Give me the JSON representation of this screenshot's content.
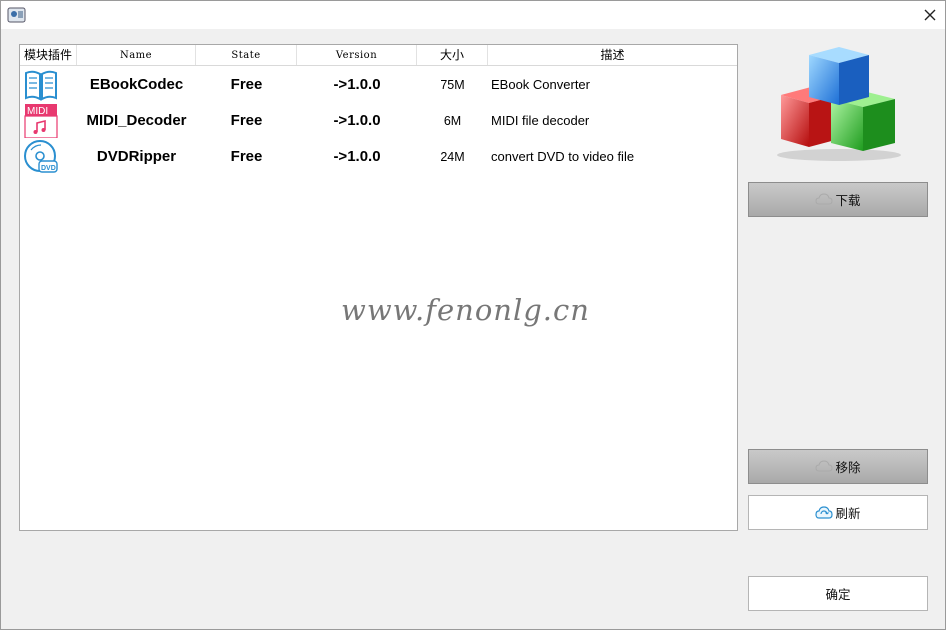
{
  "window": {
    "close_icon": "close-icon",
    "app_icon": "app-icon"
  },
  "table": {
    "columns": [
      "模块插件",
      "Name",
      "State",
      "Version",
      "大小",
      "描述"
    ],
    "rows": [
      {
        "icon": "ebook-icon",
        "name": "EBookCodec",
        "state": "Free",
        "version": "->1.0.0",
        "size": "75M",
        "description": "EBook Converter"
      },
      {
        "icon": "midi-icon",
        "icon_text": "MIDI",
        "name": "MIDI_Decoder",
        "state": "Free",
        "version": "->1.0.0",
        "size": "6M",
        "description": "MIDI file decoder"
      },
      {
        "icon": "dvd-icon",
        "icon_text": "DVD",
        "name": "DVDRipper",
        "state": "Free",
        "version": "->1.0.0",
        "size": "24M",
        "description": "convert DVD to video file"
      }
    ]
  },
  "watermark": "www.fenonlg.cn",
  "buttons": {
    "download": "下载",
    "remove": "移除",
    "refresh": "刷新",
    "ok": "确定"
  },
  "colors": {
    "midi_accent": "#e8386f",
    "icon_blue": "#2a8fd0"
  }
}
